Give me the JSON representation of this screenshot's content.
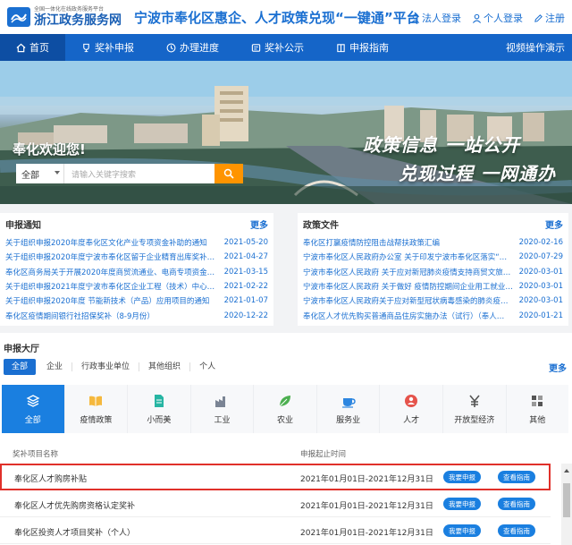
{
  "logo": {
    "small": "全国一体化在线政务服务平台",
    "big": "浙江政务服务网"
  },
  "site_title": "宁波市奉化区惠企、人才政策兑现“一键通”平台",
  "header_links": {
    "corp_login": "法人登录",
    "personal_login": "个人登录",
    "register": "注册"
  },
  "nav": {
    "items": [
      {
        "label": "首页",
        "icon": "home-icon"
      },
      {
        "label": "奖补申报",
        "icon": "trophy-icon"
      },
      {
        "label": "办理进度",
        "icon": "clock-icon"
      },
      {
        "label": "奖补公示",
        "icon": "notice-icon"
      },
      {
        "label": "申报指南",
        "icon": "book-icon"
      }
    ],
    "right": "视频操作演示"
  },
  "banner": {
    "welcome": "奉化欢迎您!",
    "search_scope": "全部",
    "search_placeholder": "请输入关键字搜索",
    "slogan1": "政策信息 一站公开",
    "slogan2": "兑现过程 一网通办"
  },
  "notices": {
    "title": "申报通知",
    "more": "更多",
    "items": [
      {
        "title": "关于组织申报2020年度奉化区文化产业专项资金补助的通知",
        "date": "2021-05-20"
      },
      {
        "title": "关于组织申报2020年度宁波市奉化区留于企业精育出库奖补…",
        "date": "2021-04-27"
      },
      {
        "title": "奉化区商务局关于开展2020年度商贸流通业、电商专项资金…",
        "date": "2021-03-15"
      },
      {
        "title": "关于组织申报2021年度宁波市奉化区企业工程（技术）中心…",
        "date": "2021-02-22"
      },
      {
        "title": "关于组织申报2020年度 节能新技术（产品）应用项目的通知",
        "date": "2021-01-07"
      },
      {
        "title": "奉化区疫情期间银行社招保奖补（8-9月份）",
        "date": "2020-12-22"
      }
    ]
  },
  "policies": {
    "title": "政策文件",
    "more": "更多",
    "items": [
      {
        "title": "奉化区打赢疫情防控阻击战帮扶政策汇编",
        "date": "2020-02-16"
      },
      {
        "title": "宁波市奉化区人民政府办公室 关于印发宁波市奉化区落实“…",
        "date": "2020-07-29"
      },
      {
        "title": "宁波市奉化区人民政府 关于应对新冠肺炎疫情支持商贸文旅…",
        "date": "2020-03-01"
      },
      {
        "title": "宁波市奉化区人民政府 关于做好 疫情防控期间企业用工就业…",
        "date": "2020-03-01"
      },
      {
        "title": "宁波市奉化区人民政府关于应对新型冠状病毒感染的肺炎疫情…",
        "date": "2020-03-01"
      },
      {
        "title": "奉化区人才优先购买普通商品住房实施办法（试行）（奉人…",
        "date": "2020-01-21"
      }
    ]
  },
  "hall": {
    "title": "申报大厅",
    "more": "更多",
    "filters": [
      "全部",
      "企业",
      "行政事业单位",
      "其他组织",
      "个人"
    ],
    "categories": [
      {
        "label": "全部",
        "icon": "layers-icon"
      },
      {
        "label": "疫情政策",
        "icon": "book-open-icon"
      },
      {
        "label": "小而美",
        "icon": "document-icon"
      },
      {
        "label": "工业",
        "icon": "factory-icon"
      },
      {
        "label": "农业",
        "icon": "leaf-icon"
      },
      {
        "label": "服务业",
        "icon": "coffee-icon"
      },
      {
        "label": "人才",
        "icon": "person-icon"
      },
      {
        "label": "开放型经济",
        "icon": "yen-icon"
      },
      {
        "label": "其他",
        "icon": "grid-icon"
      }
    ],
    "columns": {
      "name": "奖补项目名称",
      "period": "申报起止时间"
    },
    "rows": [
      {
        "name": "奉化区人才购房补贴",
        "period": "2021年01月01日-2021年12月31日",
        "apply": "我要申报",
        "guide": "查看指南"
      },
      {
        "name": "奉化区人才优先购房资格认定奖补",
        "period": "2021年01月01日-2021年12月31日",
        "apply": "我要申报",
        "guide": "查看指南"
      },
      {
        "name": "奉化区投资人才项目奖补（个人）",
        "period": "2021年01月01日-2021年12月31日",
        "apply": "我要申报",
        "guide": "查看指南"
      }
    ]
  },
  "colors": {
    "brand": "#1565c8",
    "accent": "#ff9400",
    "highlight": "#e0302a"
  }
}
